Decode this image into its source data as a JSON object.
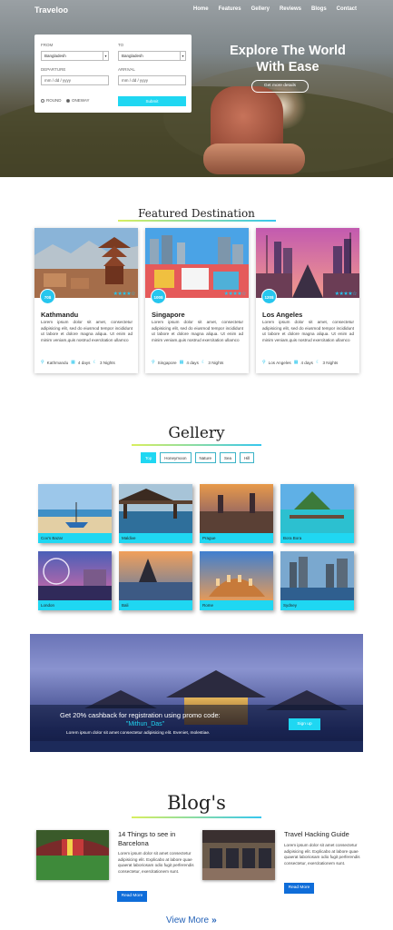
{
  "nav": {
    "brand": "Traveloo",
    "items": [
      "Home",
      "Features",
      "Gellery",
      "Reviews",
      "Blogs",
      "Contact"
    ]
  },
  "search": {
    "from_label": "FROM",
    "from_value": "Bangladesh",
    "to_label": "TO",
    "to_value": "Bangladesh",
    "departure_label": "DEPARTURE",
    "departure_placeholder": "mm / dd / yyyy",
    "arrival_label": "ARRIVAL",
    "arrival_placeholder": "mm / dd / yyyy",
    "round_label": "ROUND",
    "oneway_label": "ONEWAY",
    "selected_trip": "ONEWAY",
    "submit_label": "Submit"
  },
  "hero": {
    "title": "Explore The World With Ease",
    "button": "Get more details"
  },
  "featured": {
    "title": "Featured Destination",
    "cards": [
      {
        "price": "70$",
        "rating": 4.5,
        "name": "Kathmandu",
        "desc": "Lorem ipsum dolor sit amet, consectetur adipisicing elit, sed do eiusmod tempor incididunt ut labore et dolore magna aliqua. Ut enim ad minim veniam,quis nostrud exercitation ullamco",
        "location": "Kathmandu",
        "days": "4 days",
        "nights": "3 Nights"
      },
      {
        "price": "100$",
        "rating": 4.5,
        "name": "Singapore",
        "desc": "Lorem ipsum dolor sit amet, consectetur adipisicing elit, sed do eiusmod tempor incididunt ut labore et dolore magna aliqua. Ut enim ad minim veniam,quis nostrud exercitation ullamco",
        "location": "Singapore",
        "days": "4 days",
        "nights": "3 Nights"
      },
      {
        "price": "120$",
        "rating": 4.5,
        "name": "Los Angeles",
        "desc": "Lorem ipsum dolor sit amet, consectetur adipisicing elit, sed do eiusmod tempor incididunt ut labore et dolore magna aliqua. Ut enim ad minim veniam,quis nostrud exercitation ullamco",
        "location": "Los Angeles",
        "days": "4 days",
        "nights": "3 Nights"
      }
    ]
  },
  "gallery": {
    "title": "Gellery",
    "tabs": [
      "Top",
      "Honeymoon",
      "Nature",
      "Sea",
      "Hill"
    ],
    "active_tab": "Top",
    "items": [
      "Cox's Bazar",
      "Maldive",
      "Prague",
      "Bora Bora",
      "London",
      "Bali",
      "Rome",
      "Sydney"
    ]
  },
  "promo": {
    "line1": "Get 20% cashback for registration using promo code:",
    "code": "\"Mithun_Das\"",
    "line3": "Lorem ipsum dolor sit amet consectetur adipisicing elit. Eveniet, molestiae.",
    "button": "Sign up"
  },
  "blog": {
    "title": "Blog's",
    "posts": [
      {
        "title": "14 Things to see in Barcelona",
        "text": "Lorem ipsum dolor sit amet consectetur adipisicing elit. Explicabo at labore quae quaerat laboriosam odio fugit perferendis consectetur, exercitationem sunt.",
        "button": "Read More"
      },
      {
        "title": "Travel Hacking Guide",
        "text": "Lorem ipsum dolor sit amet consectetur adipisicing elit. Explicabo at labore quae quaerat laboriosam odio fugit perferendis consectetur, exercitationem sunt.",
        "button": "Read More"
      }
    ],
    "view_more": "View More"
  },
  "colors": {
    "accent": "#1fd7f2",
    "blog_button": "#0f6dd9",
    "view_more": "#2563b8"
  }
}
